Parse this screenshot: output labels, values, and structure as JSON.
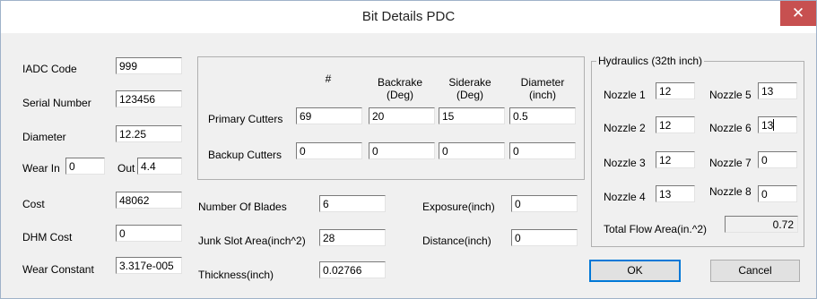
{
  "window": {
    "title": "Bit Details PDC",
    "close_label": "✕"
  },
  "left": {
    "iadc_code_label": "IADC Code",
    "iadc_code": "999",
    "serial_label": "Serial Number",
    "serial": "123456",
    "diameter_label": "Diameter",
    "diameter": "12.25",
    "wear_in_label": "Wear In",
    "wear_in": "0",
    "wear_out_label": "Out",
    "wear_out": "4.4",
    "cost_label": "Cost",
    "cost": "48062",
    "dhm_cost_label": "DHM Cost",
    "dhm_cost": "0",
    "wear_constant_label": "Wear Constant",
    "wear_constant": "3.317e-005"
  },
  "cutters": {
    "headers": {
      "count": "#",
      "backrake": "Backrake\n(Deg)",
      "siderake": "Siderake\n(Deg)",
      "diameter": "Diameter\n(inch)"
    },
    "primary": {
      "label": "Primary Cutters",
      "count": "69",
      "backrake": "20",
      "siderake": "15",
      "diameter": "0.5"
    },
    "backup": {
      "label": "Backup Cutters",
      "count": "0",
      "backrake": "0",
      "siderake": "0",
      "diameter": "0"
    }
  },
  "mid": {
    "blades_label": "Number Of Blades",
    "blades": "6",
    "junk_label": "Junk Slot Area(inch^2)",
    "junk": "28",
    "thickness_label": "Thickness(inch)",
    "thickness": "0.02766",
    "exposure_label": "Exposure(inch)",
    "exposure": "0",
    "distance_label": "Distance(inch)",
    "distance": "0"
  },
  "hydraulics": {
    "title": "Hydraulics (32th inch)",
    "nozzles": [
      {
        "label": "Nozzle 1",
        "value": "12"
      },
      {
        "label": "Nozzle 2",
        "value": "12"
      },
      {
        "label": "Nozzle 3",
        "value": "12"
      },
      {
        "label": "Nozzle 4",
        "value": "13"
      },
      {
        "label": "Nozzle 5",
        "value": "13"
      },
      {
        "label": "Nozzle 6",
        "value": "13"
      },
      {
        "label": "Nozzle 7",
        "value": "0"
      },
      {
        "label": "Nozzle 8",
        "value": "0"
      }
    ],
    "tfa_label": "Total Flow Area(in.^2)",
    "tfa": "0.72"
  },
  "buttons": {
    "ok": "OK",
    "cancel": "Cancel"
  }
}
